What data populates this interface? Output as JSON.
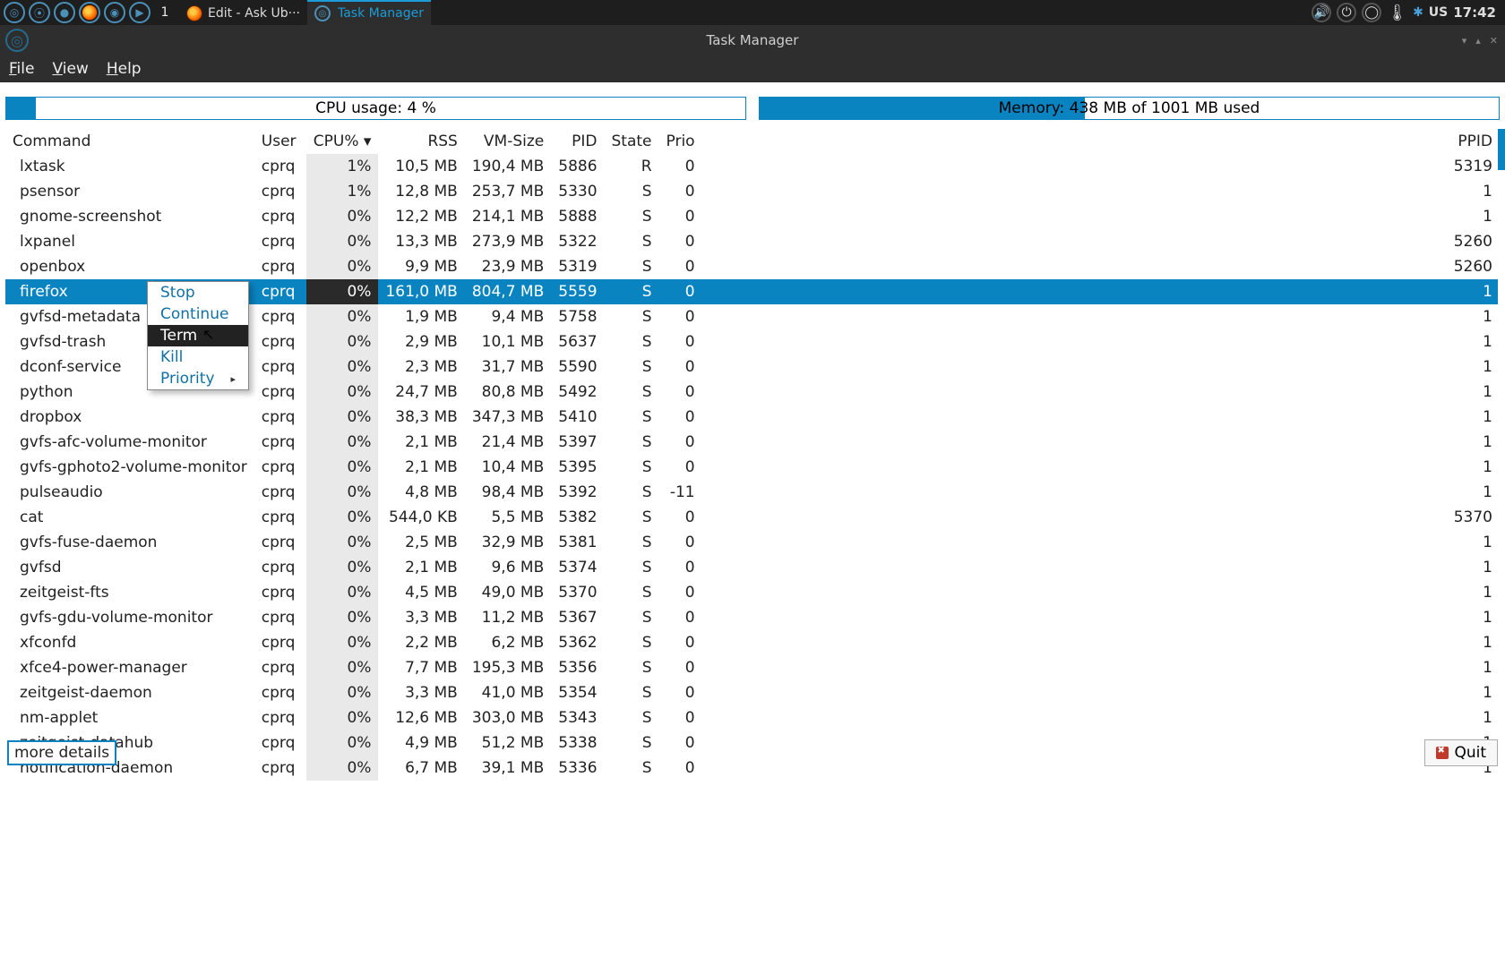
{
  "panel": {
    "workspace": "1",
    "taskbar": [
      {
        "label": "Edit - Ask Ub···",
        "active": false,
        "icon": "firefox"
      },
      {
        "label": "Task Manager",
        "active": true,
        "icon": "task"
      }
    ],
    "locale": "US",
    "clock": "17:42"
  },
  "window": {
    "title": "Task Manager",
    "menu": [
      "File",
      "View",
      "Help"
    ],
    "cpu_label": "CPU usage: 4 %",
    "cpu_fill_percent": 4,
    "mem_label": "Memory: 438 MB of 1001 MB used",
    "mem_fill_percent": 44,
    "columns": [
      "Command",
      "User",
      "CPU% ▾",
      "RSS",
      "VM-Size",
      "PID",
      "State",
      "Prio",
      "PPID"
    ],
    "more_details": "more details",
    "quit": "Quit"
  },
  "context_menu": {
    "items": [
      "Stop",
      "Continue",
      "Term",
      "Kill",
      "Priority"
    ],
    "hover_index": 2,
    "submenu_index": 4
  },
  "processes": [
    {
      "cmd": "lxtask",
      "user": "cprq",
      "cpu": "1%",
      "rss": "10,5 MB",
      "vm": "190,4 MB",
      "pid": "5886",
      "state": "R",
      "prio": "0",
      "ppid": "5319"
    },
    {
      "cmd": "psensor",
      "user": "cprq",
      "cpu": "1%",
      "rss": "12,8 MB",
      "vm": "253,7 MB",
      "pid": "5330",
      "state": "S",
      "prio": "0",
      "ppid": "1"
    },
    {
      "cmd": "gnome-screenshot",
      "user": "cprq",
      "cpu": "0%",
      "rss": "12,2 MB",
      "vm": "214,1 MB",
      "pid": "5888",
      "state": "S",
      "prio": "0",
      "ppid": "1"
    },
    {
      "cmd": "lxpanel",
      "user": "cprq",
      "cpu": "0%",
      "rss": "13,3 MB",
      "vm": "273,9 MB",
      "pid": "5322",
      "state": "S",
      "prio": "0",
      "ppid": "5260"
    },
    {
      "cmd": "openbox",
      "user": "cprq",
      "cpu": "0%",
      "rss": "9,9 MB",
      "vm": "23,9 MB",
      "pid": "5319",
      "state": "S",
      "prio": "0",
      "ppid": "5260"
    },
    {
      "cmd": "firefox",
      "user": "cprq",
      "cpu": "0%",
      "rss": "161,0 MB",
      "vm": "804,7 MB",
      "pid": "5559",
      "state": "S",
      "prio": "0",
      "ppid": "1",
      "selected": true
    },
    {
      "cmd": "gvfsd-metadata",
      "user": "cprq",
      "cpu": "0%",
      "rss": "1,9 MB",
      "vm": "9,4 MB",
      "pid": "5758",
      "state": "S",
      "prio": "0",
      "ppid": "1"
    },
    {
      "cmd": "gvfsd-trash",
      "user": "cprq",
      "cpu": "0%",
      "rss": "2,9 MB",
      "vm": "10,1 MB",
      "pid": "5637",
      "state": "S",
      "prio": "0",
      "ppid": "1"
    },
    {
      "cmd": "dconf-service",
      "user": "cprq",
      "cpu": "0%",
      "rss": "2,3 MB",
      "vm": "31,7 MB",
      "pid": "5590",
      "state": "S",
      "prio": "0",
      "ppid": "1"
    },
    {
      "cmd": "python",
      "user": "cprq",
      "cpu": "0%",
      "rss": "24,7 MB",
      "vm": "80,8 MB",
      "pid": "5492",
      "state": "S",
      "prio": "0",
      "ppid": "1"
    },
    {
      "cmd": "dropbox",
      "user": "cprq",
      "cpu": "0%",
      "rss": "38,3 MB",
      "vm": "347,3 MB",
      "pid": "5410",
      "state": "S",
      "prio": "0",
      "ppid": "1"
    },
    {
      "cmd": "gvfs-afc-volume-monitor",
      "user": "cprq",
      "cpu": "0%",
      "rss": "2,1 MB",
      "vm": "21,4 MB",
      "pid": "5397",
      "state": "S",
      "prio": "0",
      "ppid": "1"
    },
    {
      "cmd": "gvfs-gphoto2-volume-monitor",
      "user": "cprq",
      "cpu": "0%",
      "rss": "2,1 MB",
      "vm": "10,4 MB",
      "pid": "5395",
      "state": "S",
      "prio": "0",
      "ppid": "1"
    },
    {
      "cmd": "pulseaudio",
      "user": "cprq",
      "cpu": "0%",
      "rss": "4,8 MB",
      "vm": "98,4 MB",
      "pid": "5392",
      "state": "S",
      "prio": "-11",
      "ppid": "1"
    },
    {
      "cmd": "cat",
      "user": "cprq",
      "cpu": "0%",
      "rss": "544,0 KB",
      "vm": "5,5 MB",
      "pid": "5382",
      "state": "S",
      "prio": "0",
      "ppid": "5370"
    },
    {
      "cmd": "gvfs-fuse-daemon",
      "user": "cprq",
      "cpu": "0%",
      "rss": "2,5 MB",
      "vm": "32,9 MB",
      "pid": "5381",
      "state": "S",
      "prio": "0",
      "ppid": "1"
    },
    {
      "cmd": "gvfsd",
      "user": "cprq",
      "cpu": "0%",
      "rss": "2,1 MB",
      "vm": "9,6 MB",
      "pid": "5374",
      "state": "S",
      "prio": "0",
      "ppid": "1"
    },
    {
      "cmd": "zeitgeist-fts",
      "user": "cprq",
      "cpu": "0%",
      "rss": "4,5 MB",
      "vm": "49,0 MB",
      "pid": "5370",
      "state": "S",
      "prio": "0",
      "ppid": "1"
    },
    {
      "cmd": "gvfs-gdu-volume-monitor",
      "user": "cprq",
      "cpu": "0%",
      "rss": "3,3 MB",
      "vm": "11,2 MB",
      "pid": "5367",
      "state": "S",
      "prio": "0",
      "ppid": "1"
    },
    {
      "cmd": "xfconfd",
      "user": "cprq",
      "cpu": "0%",
      "rss": "2,2 MB",
      "vm": "6,2 MB",
      "pid": "5362",
      "state": "S",
      "prio": "0",
      "ppid": "1"
    },
    {
      "cmd": "xfce4-power-manager",
      "user": "cprq",
      "cpu": "0%",
      "rss": "7,7 MB",
      "vm": "195,3 MB",
      "pid": "5356",
      "state": "S",
      "prio": "0",
      "ppid": "1"
    },
    {
      "cmd": "zeitgeist-daemon",
      "user": "cprq",
      "cpu": "0%",
      "rss": "3,3 MB",
      "vm": "41,0 MB",
      "pid": "5354",
      "state": "S",
      "prio": "0",
      "ppid": "1"
    },
    {
      "cmd": "nm-applet",
      "user": "cprq",
      "cpu": "0%",
      "rss": "12,6 MB",
      "vm": "303,0 MB",
      "pid": "5343",
      "state": "S",
      "prio": "0",
      "ppid": "1"
    },
    {
      "cmd": "zeitgeist-datahub",
      "user": "cprq",
      "cpu": "0%",
      "rss": "4,9 MB",
      "vm": "51,2 MB",
      "pid": "5338",
      "state": "S",
      "prio": "0",
      "ppid": "1"
    },
    {
      "cmd": "notification-daemon",
      "user": "cprq",
      "cpu": "0%",
      "rss": "6,7 MB",
      "vm": "39,1 MB",
      "pid": "5336",
      "state": "S",
      "prio": "0",
      "ppid": "1"
    }
  ]
}
